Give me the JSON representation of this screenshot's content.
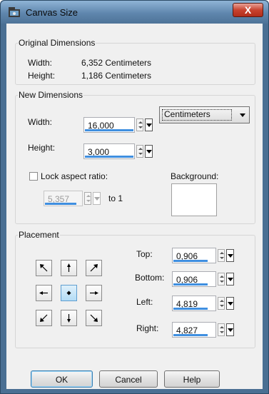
{
  "window": {
    "title": "Canvas Size",
    "close_label": "X"
  },
  "original": {
    "legend": "Original Dimensions",
    "width_label": "Width:",
    "width_value": "6,352 Centimeters",
    "height_label": "Height:",
    "height_value": "1,186 Centimeters"
  },
  "new_dims": {
    "legend": "New Dimensions",
    "width_label": "Width:",
    "width_value": "16,000",
    "height_label": "Height:",
    "height_value": "3,000",
    "units": "Centimeters",
    "lock_label": "Lock aspect ratio:",
    "lock_checked": false,
    "ratio_value": "5,357",
    "ratio_suffix": "to 1",
    "background_label": "Background:",
    "background_color": "#ffffff"
  },
  "placement": {
    "legend": "Placement",
    "selected": "center",
    "top_label": "Top:",
    "top_value": "0,906",
    "bottom_label": "Bottom:",
    "bottom_value": "0,906",
    "left_label": "Left:",
    "left_value": "4,819",
    "right_label": "Right:",
    "right_value": "4,827"
  },
  "buttons": {
    "ok": "OK",
    "cancel": "Cancel",
    "help": "Help"
  },
  "colors": {
    "accent": "#3f8fe0",
    "titlebar": "#5f86ad",
    "close": "#c8432f"
  }
}
